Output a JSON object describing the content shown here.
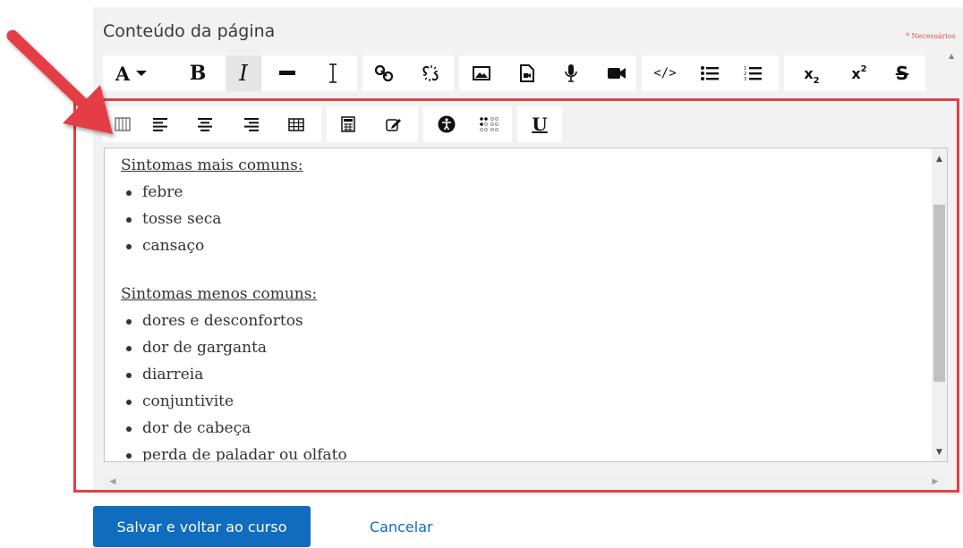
{
  "form": {
    "section_title": "Conteúdo da página",
    "required_note": "* Necessários"
  },
  "toolbar": {
    "row1": [
      {
        "icon": "font-color-icon",
        "label": "A"
      },
      {
        "icon": "bold-icon",
        "label": "B"
      },
      {
        "icon": "italic-icon",
        "label": "I"
      },
      {
        "icon": "horizontal-rule-icon"
      },
      {
        "icon": "clear-format-icon"
      },
      {
        "icon": "link-icon"
      },
      {
        "icon": "unlink-icon"
      },
      {
        "icon": "image-icon"
      },
      {
        "icon": "media-icon"
      },
      {
        "icon": "microphone-icon"
      },
      {
        "icon": "video-camera-icon"
      },
      {
        "icon": "html-code-icon",
        "label": "</>"
      },
      {
        "icon": "bulleted-list-icon"
      },
      {
        "icon": "numbered-list-icon"
      },
      {
        "icon": "subscript-icon",
        "label": "x",
        "sub": "2"
      },
      {
        "icon": "superscript-icon",
        "label": "x",
        "sup": "2"
      },
      {
        "icon": "strikethrough-icon",
        "label": "S"
      }
    ],
    "row2": [
      {
        "icon": "rtl-icon"
      },
      {
        "icon": "align-left-icon"
      },
      {
        "icon": "align-center-icon"
      },
      {
        "icon": "align-right-icon"
      },
      {
        "icon": "table-icon"
      },
      {
        "icon": "calculator-icon"
      },
      {
        "icon": "edit-icon"
      },
      {
        "icon": "accessibility-icon"
      },
      {
        "icon": "braille-icon"
      },
      {
        "icon": "underline-icon",
        "label": "U"
      }
    ]
  },
  "editor": {
    "heading1": "Sintomas mais comuns:",
    "list1": [
      "febre",
      "tosse seca",
      "cansaço"
    ],
    "heading2": "Sintomas menos comuns:",
    "list2": [
      "dores e desconfortos",
      "dor de garganta",
      "diarreia",
      "conjuntivite",
      "dor de cabeça",
      "perda de paladar ou olfato"
    ]
  },
  "actions": {
    "save_label": "Salvar e voltar ao curso",
    "cancel_label": "Cancelar"
  },
  "colors": {
    "highlight_border": "#e2404a",
    "primary_button": "#0f6cbf",
    "required": "#d9534f"
  }
}
